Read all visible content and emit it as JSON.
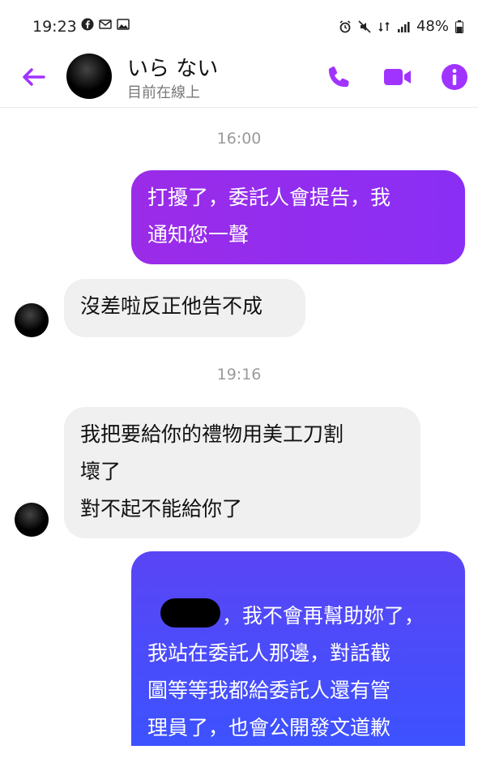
{
  "status_bar": {
    "time": "19:23",
    "battery": "48%"
  },
  "header": {
    "name": "いら ない",
    "status": "目前在線上"
  },
  "messages": {
    "ts1": "16:00",
    "m1": "打擾了，委託人會提告，我\n通知您一聲",
    "m2": "沒差啦反正他告不成",
    "ts2": "19:16",
    "m3": "我把要給你的禮物用美工刀割\n壞了\n對不起不能給你了",
    "m4_first": "，我不會再幫助妳了，",
    "m4_rest": "我站在委託人那邊，對話截\n圖等等我都給委託人還有管\n理員了，也會公開發文道歉\n並說妳還活著並附上我們的"
  },
  "colors": {
    "accent": "#a033ff",
    "outgoing_top": "#9b2ce8",
    "outgoing_bottom": "#4a4cff",
    "incoming_bg": "#f0f0f0"
  }
}
